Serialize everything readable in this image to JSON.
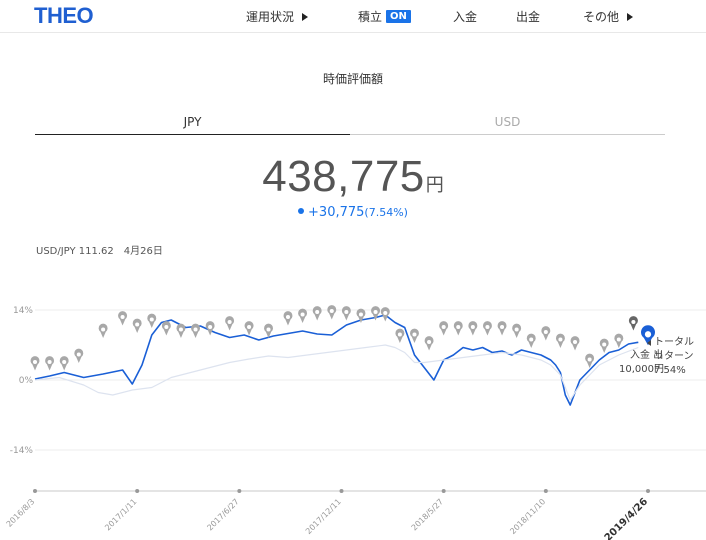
{
  "header": {
    "logo": "THEO",
    "nav": [
      {
        "label": "運用状況",
        "arrow": true
      },
      {
        "label": "積立",
        "badge": "ON"
      },
      {
        "label": "入金"
      },
      {
        "label": "出金"
      },
      {
        "label": "その他",
        "arrow": true
      }
    ]
  },
  "page_title": "時価評価額",
  "tabs": [
    {
      "label": "JPY",
      "active": true
    },
    {
      "label": "USD",
      "active": false
    }
  ],
  "valuation": {
    "amount": "438,775",
    "unit": "円",
    "change": "+30,775",
    "change_pct": "(7.54%)"
  },
  "fx_rate": {
    "label": "USD/JPY 111.62",
    "date": "4月26日"
  },
  "annotations": {
    "deposit_label": "入金",
    "deposit_icon": "出",
    "deposit_amount": "10,000円",
    "total_return_label_1": "トータル",
    "total_return_label_2": "リターン",
    "total_return_value": "7.54%"
  },
  "colors": {
    "brand": "#1f5fd1",
    "accent": "#1a73e8",
    "benchmark": "#dde3ef",
    "marker": "#a8a8a8"
  },
  "chart_data": {
    "type": "line",
    "ylabel": "",
    "y_ticks": [
      "14%",
      "0%",
      "-14%"
    ],
    "y_tick_values": [
      14,
      0,
      -14
    ],
    "ylim": [
      -22,
      22
    ],
    "x_tick_labels": [
      "2016/8/3",
      "2017/1/11",
      "2017/6/27",
      "2017/12/11",
      "2018/5/27",
      "2018/11/10",
      "2019/4/26"
    ],
    "grid": true,
    "series": [
      {
        "color": "#1a5fd6",
        "points": [
          [
            0,
            0.2
          ],
          [
            3,
            0.8
          ],
          [
            6,
            1.5
          ],
          [
            10,
            0.5
          ],
          [
            14,
            1.2
          ],
          [
            18,
            2.0
          ],
          [
            20,
            -0.8
          ],
          [
            22,
            3.0
          ],
          [
            24,
            9.0
          ],
          [
            26,
            11.5
          ],
          [
            28,
            12.0
          ],
          [
            31,
            10.5
          ],
          [
            34,
            10.8
          ],
          [
            37,
            9.5
          ],
          [
            40,
            8.5
          ],
          [
            43,
            9.0
          ],
          [
            46,
            8.0
          ],
          [
            49,
            8.8
          ],
          [
            52,
            9.3
          ],
          [
            55,
            9.8
          ],
          [
            58,
            9.2
          ],
          [
            61,
            9.0
          ],
          [
            64,
            11.0
          ],
          [
            67,
            12.0
          ],
          [
            70,
            12.5
          ],
          [
            72,
            13.0
          ],
          [
            74,
            11.5
          ],
          [
            76,
            10.5
          ],
          [
            78,
            5.0
          ],
          [
            80,
            2.5
          ],
          [
            82,
            0.0
          ],
          [
            84,
            4.0
          ],
          [
            86,
            5.0
          ],
          [
            88,
            6.5
          ],
          [
            90,
            6.0
          ],
          [
            92,
            6.5
          ],
          [
            94,
            5.5
          ],
          [
            96,
            5.8
          ],
          [
            98,
            5.0
          ],
          [
            100,
            6.0
          ],
          [
            102,
            5.5
          ],
          [
            104,
            5.0
          ],
          [
            106,
            4.0
          ],
          [
            107,
            3.0
          ],
          [
            108,
            1.5
          ],
          [
            109,
            -3.0
          ],
          [
            110,
            -5.0
          ],
          [
            112,
            0.0
          ],
          [
            114,
            2.0
          ],
          [
            116,
            4.0
          ],
          [
            118,
            5.5
          ],
          [
            120,
            6.0
          ],
          [
            122,
            7.2
          ],
          [
            124,
            7.54
          ]
        ]
      },
      {
        "color": "#dde3ef",
        "points": [
          [
            0,
            0
          ],
          [
            5,
            0.5
          ],
          [
            10,
            -1.0
          ],
          [
            13,
            -2.5
          ],
          [
            16,
            -3.0
          ],
          [
            20,
            -2.0
          ],
          [
            24,
            -1.5
          ],
          [
            28,
            0.5
          ],
          [
            32,
            1.5
          ],
          [
            36,
            2.5
          ],
          [
            40,
            3.5
          ],
          [
            44,
            4.2
          ],
          [
            48,
            4.8
          ],
          [
            52,
            4.5
          ],
          [
            56,
            5.0
          ],
          [
            60,
            5.5
          ],
          [
            64,
            6.0
          ],
          [
            68,
            6.5
          ],
          [
            72,
            7.0
          ],
          [
            74,
            6.5
          ],
          [
            76,
            5.5
          ],
          [
            78,
            3.5
          ],
          [
            80,
            3.5
          ],
          [
            84,
            4.0
          ],
          [
            88,
            4.5
          ],
          [
            92,
            5.0
          ],
          [
            96,
            5.5
          ],
          [
            100,
            5.0
          ],
          [
            104,
            4.0
          ],
          [
            106,
            3.0
          ],
          [
            108,
            1.0
          ],
          [
            110,
            -4.0
          ],
          [
            112,
            -1.0
          ],
          [
            114,
            1.0
          ],
          [
            116,
            3.0
          ],
          [
            120,
            5.0
          ],
          [
            124,
            6.5
          ]
        ]
      }
    ],
    "markers": [
      [
        0,
        2
      ],
      [
        3,
        2
      ],
      [
        6,
        2
      ],
      [
        9,
        3.5
      ],
      [
        14,
        8.5
      ],
      [
        18,
        11
      ],
      [
        21,
        9.5
      ],
      [
        24,
        10.5
      ],
      [
        27,
        9
      ],
      [
        30,
        8.5
      ],
      [
        33,
        8.5
      ],
      [
        36,
        9
      ],
      [
        40,
        10
      ],
      [
        44,
        9
      ],
      [
        48,
        8.5
      ],
      [
        52,
        11
      ],
      [
        55,
        11.5
      ],
      [
        58,
        12
      ],
      [
        61,
        12.2
      ],
      [
        64,
        12
      ],
      [
        67,
        11.5
      ],
      [
        70,
        12
      ],
      [
        72,
        11.8
      ],
      [
        75,
        7.5
      ],
      [
        78,
        7.5
      ],
      [
        81,
        6
      ],
      [
        84,
        9
      ],
      [
        87,
        9
      ],
      [
        90,
        9
      ],
      [
        93,
        9
      ],
      [
        96,
        9
      ],
      [
        99,
        8.5
      ],
      [
        102,
        6.5
      ],
      [
        105,
        8
      ],
      [
        108,
        6.5
      ],
      [
        111,
        6
      ],
      [
        114,
        2.5
      ],
      [
        117,
        5.5
      ],
      [
        120,
        6.5
      ],
      [
        123,
        10
      ],
      [
        126,
        7.54
      ]
    ]
  }
}
